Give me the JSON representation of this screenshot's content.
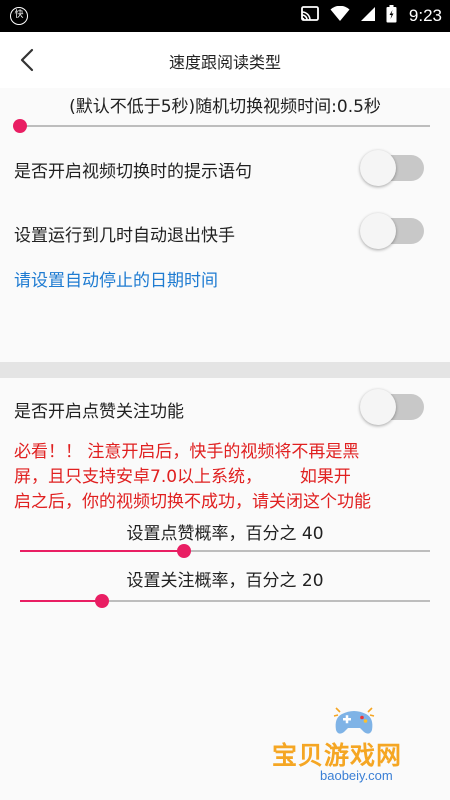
{
  "status_bar": {
    "app_badge": "快",
    "time": "9:23"
  },
  "app_bar": {
    "title": "速度跟阅读类型"
  },
  "video_switch": {
    "label": "(默认不低于5秒)随机切换视频时间:0.5秒",
    "progress": 0.0
  },
  "settings": {
    "switch_tip_label": "是否开启视频切换时的提示语句",
    "switch_tip_on": false,
    "auto_exit_label": "设置运行到几时自动退出快手",
    "auto_exit_on": false,
    "date_link": "请设置自动停止的日期时间"
  },
  "like_follow": {
    "label": "是否开启点赞关注功能",
    "enabled": false,
    "warning_lines": [
      "必看！！ 注意开启后，快手的视频将不再是黑",
      "屏，且只支持安卓7.0以上系统，       如果开",
      "启之后，你的视频切换不成功，请关闭这个功能"
    ],
    "like_rate_label": "设置点赞概率，百分之 40",
    "like_rate": 40,
    "follow_rate_label": "设置关注概率，百分之 20",
    "follow_rate": 20
  },
  "watermark": {
    "text": "宝贝游戏网",
    "url": "baobeiy.com"
  },
  "colors": {
    "accent": "#e91e63",
    "link": "#1e7bd1",
    "warning": "#e02020"
  }
}
